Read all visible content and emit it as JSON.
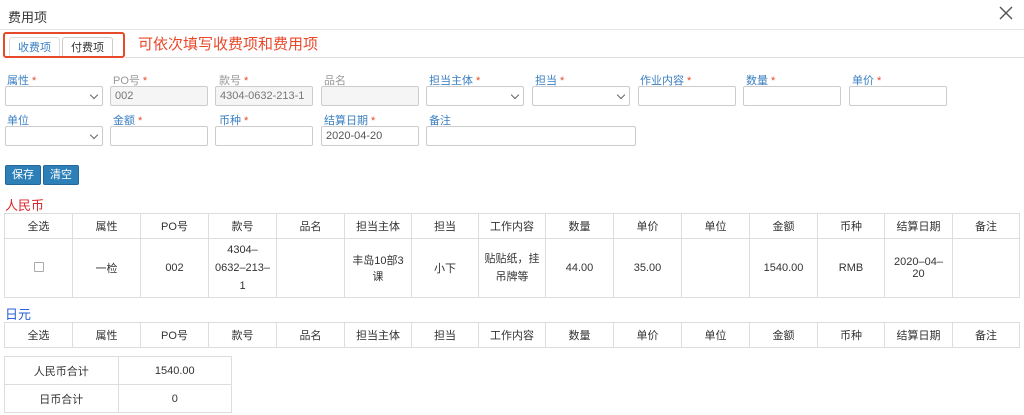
{
  "dialog": {
    "title": "费用项"
  },
  "tabs": [
    {
      "label": "收费项"
    },
    {
      "label": "付费项"
    }
  ],
  "hint": "可依次填写收费项和费用项",
  "form": {
    "row1": [
      {
        "label": "属性",
        "required": "*",
        "value": ""
      },
      {
        "label": "PO号",
        "required": "*",
        "value": "002"
      },
      {
        "label": "款号",
        "required": "*",
        "value": "4304-0632-213-1"
      },
      {
        "label": "品名",
        "required": "",
        "value": ""
      },
      {
        "label": "担当主体",
        "required": "*",
        "value": ""
      },
      {
        "label": "担当",
        "required": "*",
        "value": ""
      },
      {
        "label": "作业内容",
        "required": "*",
        "value": ""
      },
      {
        "label": "数量",
        "required": "*",
        "value": ""
      },
      {
        "label": "单价",
        "required": "*",
        "value": ""
      }
    ],
    "row2": [
      {
        "label": "单位",
        "required": "",
        "value": ""
      },
      {
        "label": "金额",
        "required": "*",
        "value": ""
      },
      {
        "label": "币种",
        "required": "*",
        "value": ""
      },
      {
        "label": "结算日期",
        "required": "*",
        "value": "2020-04-20"
      },
      {
        "label": "备注",
        "required": "",
        "value": ""
      }
    ]
  },
  "buttons": {
    "save": "保存",
    "clear": "清空"
  },
  "columns": [
    "全选",
    "属性",
    "PO号",
    "款号",
    "品名",
    "担当主体",
    "担当",
    "工作内容",
    "数量",
    "单价",
    "单位",
    "金额",
    "币种",
    "结算日期",
    "备注"
  ],
  "rmb": {
    "title": "人民币",
    "rows": [
      {
        "attr": "一检",
        "po": "002",
        "style_no": "4304–0632–213–1",
        "name": "",
        "owner_unit": "丰岛10部3课",
        "owner": "小下",
        "work": "贴贴纸，挂吊牌等",
        "qty": "44.00",
        "price": "35.00",
        "unit": "",
        "amount": "1540.00",
        "currency": "RMB",
        "date": "2020–04–20",
        "note": ""
      }
    ]
  },
  "jpy": {
    "title": "日元"
  },
  "totals": [
    {
      "label": "人民币合计",
      "value": "1540.00"
    },
    {
      "label": "日币合计",
      "value": "0"
    }
  ],
  "colors": {
    "accent": "#2d7fb8",
    "highlight": "#e8492b",
    "rmb_title": "#d9272e",
    "jpy_title": "#2b5fd8"
  }
}
